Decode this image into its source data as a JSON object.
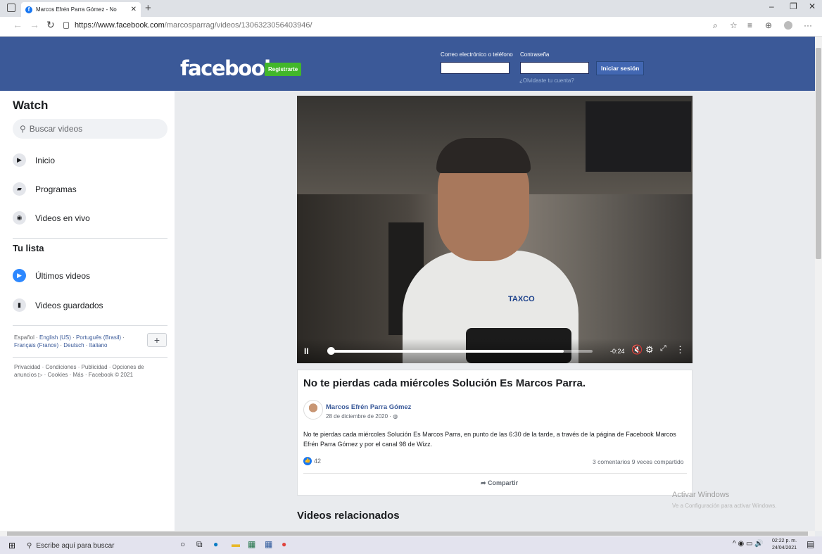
{
  "browser": {
    "tab_title": "Marcos Efrén Parra Gómez - No",
    "url_host": "https://www.facebook.com",
    "url_path": "/marcosparrag/videos/1306323056403946/"
  },
  "header": {
    "logo": "facebook",
    "signup": "Registrarte",
    "email_label": "Correo electrónico o teléfono",
    "password_label": "Contraseña",
    "login": "Iniciar sesión",
    "forgot": "¿Olvidaste tu cuenta?"
  },
  "sidebar": {
    "title": "Watch",
    "search_placeholder": "Buscar videos",
    "items": [
      {
        "label": "Inicio",
        "icon": "play-square-icon"
      },
      {
        "label": "Programas",
        "icon": "clapper-icon"
      },
      {
        "label": "Videos en vivo",
        "icon": "live-icon"
      }
    ],
    "list_title": "Tu lista",
    "list_items": [
      {
        "label": "Últimos videos",
        "icon": "play-circle-icon"
      },
      {
        "label": "Videos guardados",
        "icon": "bookmark-icon"
      }
    ],
    "languages_current": "Español",
    "languages": [
      "English (US)",
      "Português (Brasil)",
      "Français (France)",
      "Deutsch",
      "Italiano"
    ],
    "legal": "Privacidad · Condiciones · Publicidad · Opciones de anuncios ▷ · Cookies · Más · Facebook © 2021"
  },
  "video": {
    "shirt_logo": "TAXCO",
    "time_remaining": "-0:24",
    "progress": 0.89
  },
  "post": {
    "title": "No te pierdas cada miércoles Solución Es Marcos Parra.",
    "author": "Marcos Efrén Parra Gómez",
    "date": "28 de diciembre de 2020 ·",
    "body": "No te pierdas cada miércoles Solución Es Marcos Parra, en punto de las 6:30 de la tarde, a través de la página de Facebook Marcos Efrén Parra Gómez y por el canal 98 de Wizz.",
    "likes": "42",
    "stats": "3 comentarios  9 veces compartido",
    "share": "Compartir"
  },
  "related_title": "Videos relacionados",
  "watermark": {
    "line1": "Activar Windows",
    "line2": "Ve a Configuración para activar Windows."
  },
  "taskbar": {
    "search": "Escribe aquí para buscar",
    "time": "02:22 p. m.",
    "date": "24/04/2021"
  }
}
